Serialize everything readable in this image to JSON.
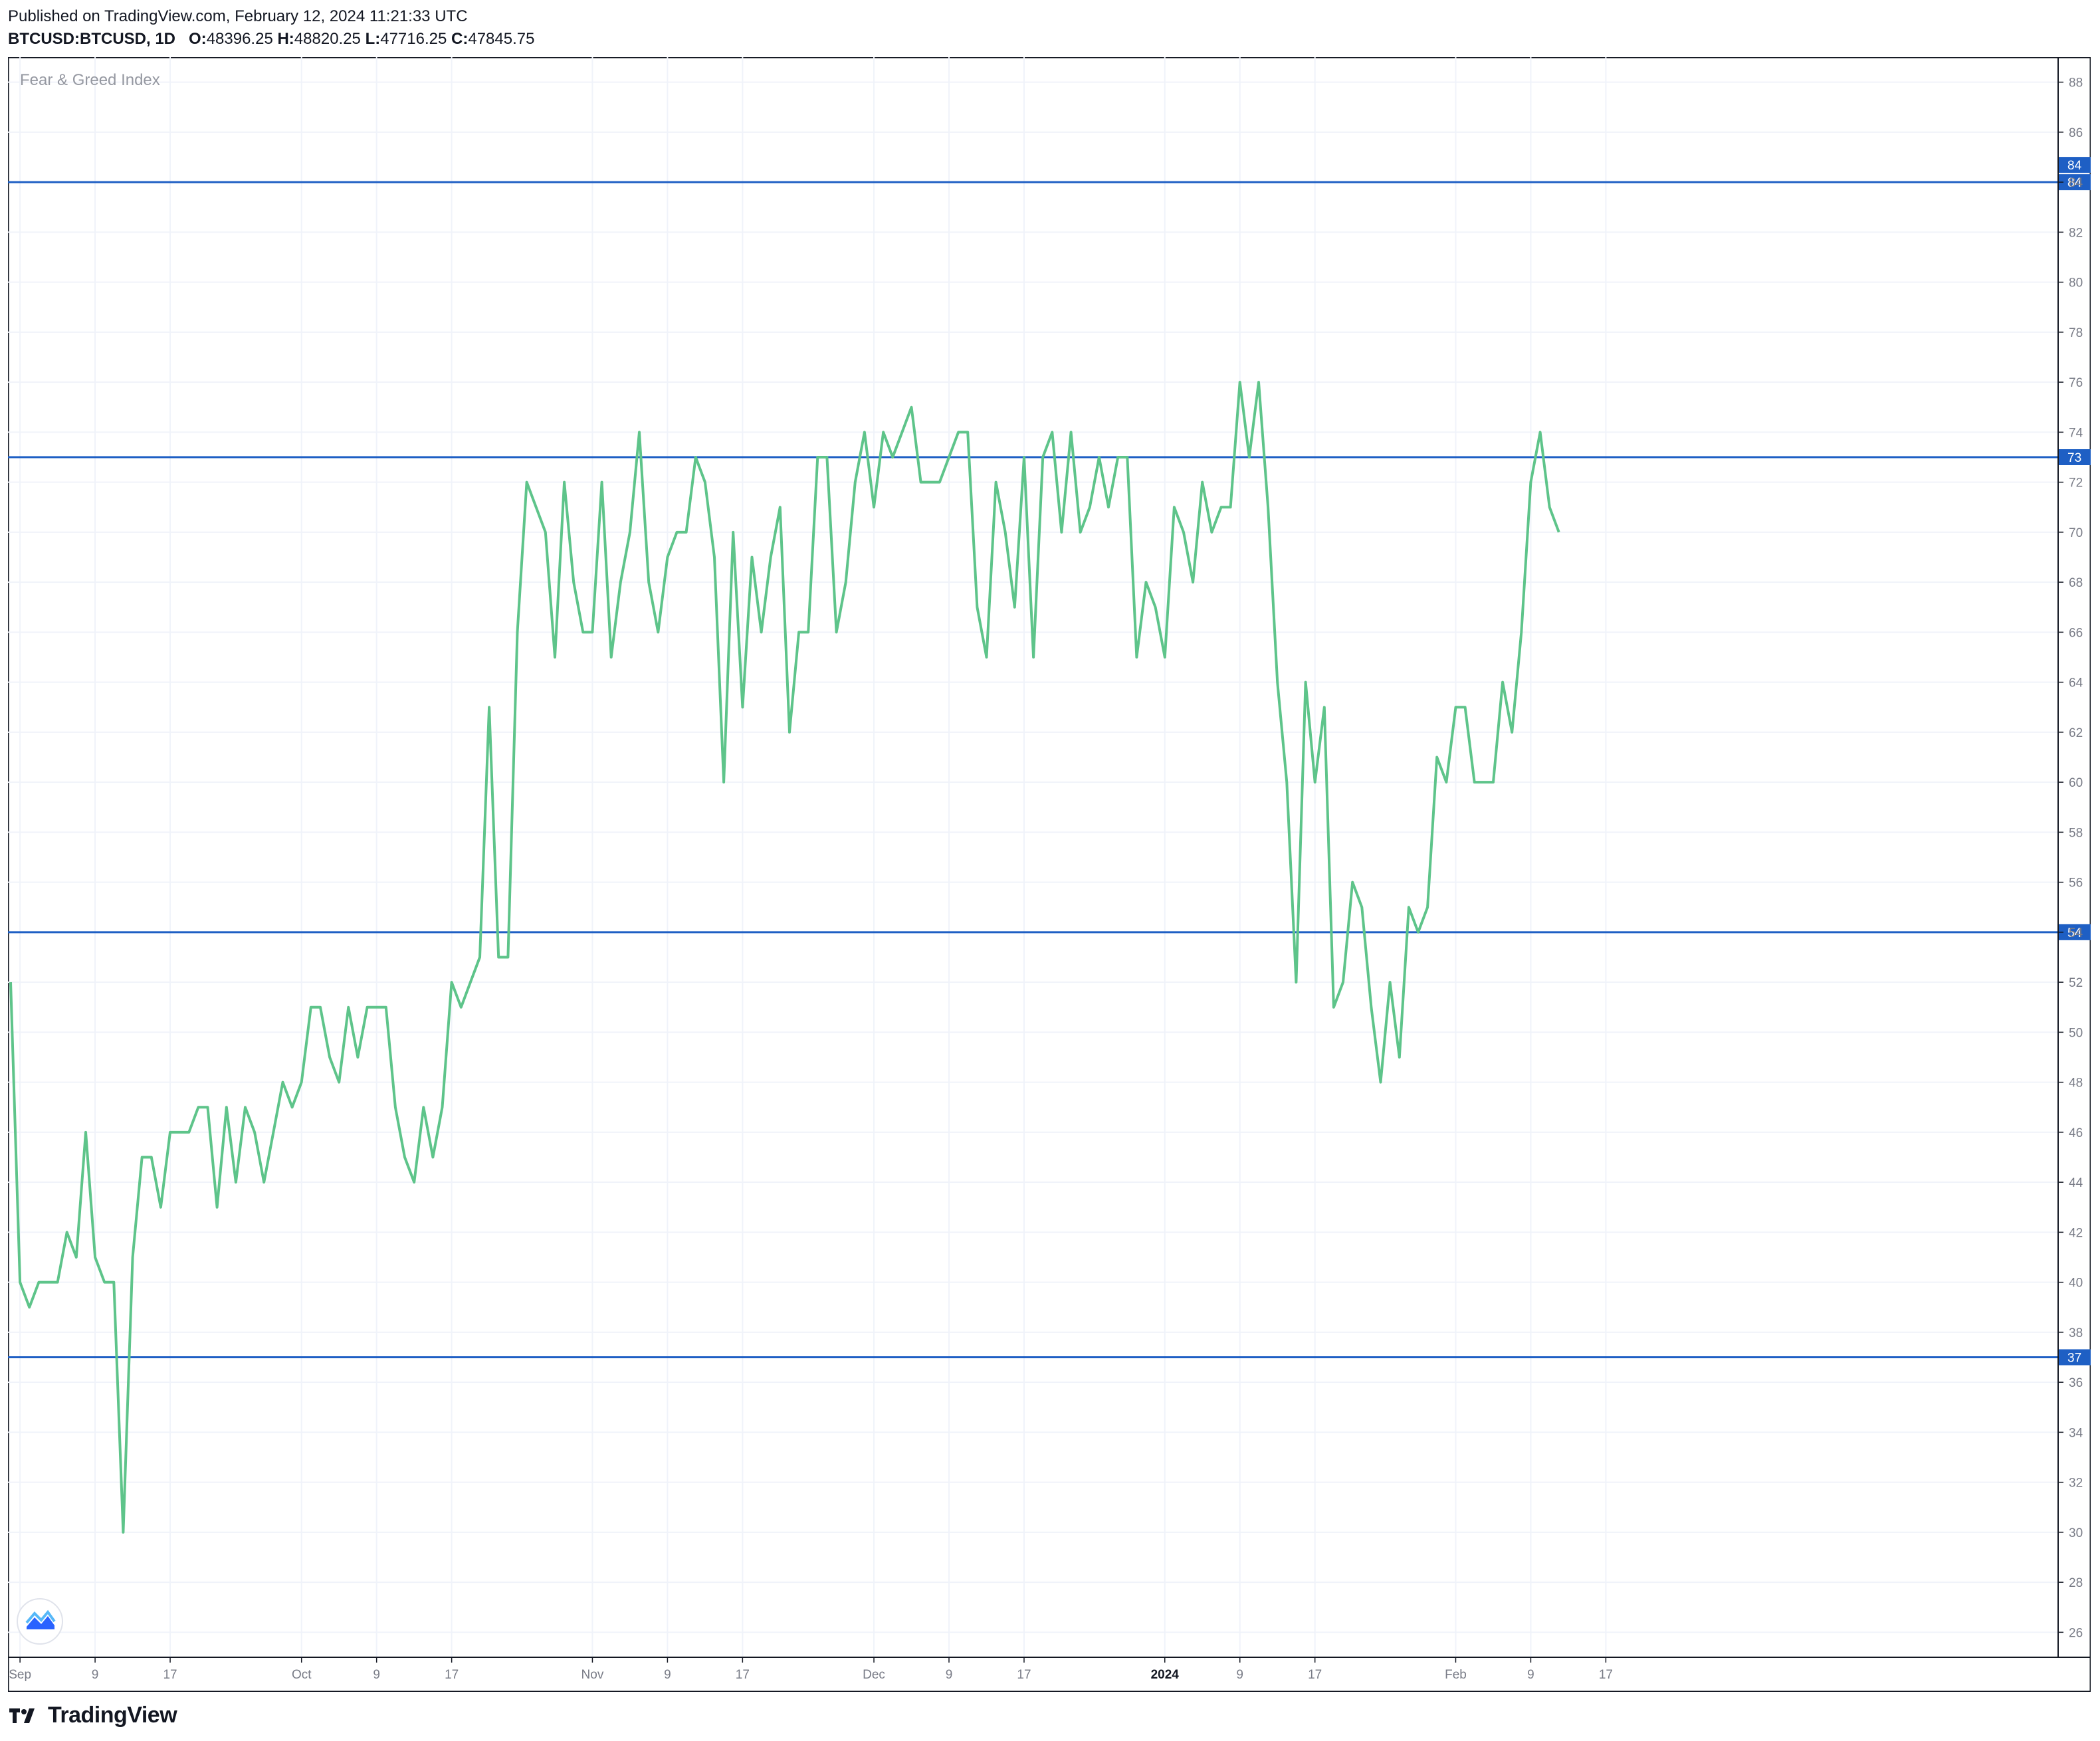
{
  "header": {
    "published": "Published on TradingView.com, February 12, 2024 11:21:33 UTC",
    "symbol": "BTCUSD:BTCUSD, 1D",
    "o_label": "O:",
    "o_value": "48396.25",
    "h_label": "H:",
    "h_value": "48820.25",
    "l_label": "L:",
    "l_value": "47716.25",
    "c_label": "C:",
    "c_value": "47845.75"
  },
  "footer": {
    "brand": "TradingView"
  },
  "colors": {
    "series": "#5ec48a",
    "hline": "#1e5fc4",
    "grid": "#f0f3fa",
    "axis_text": "#787b86"
  },
  "chart_data": {
    "type": "line",
    "title": "Fear & Greed Index",
    "xlabel": "",
    "ylabel": "",
    "ylim": [
      25,
      89
    ],
    "y_ticks": [
      26,
      28,
      30,
      32,
      34,
      36,
      38,
      40,
      42,
      44,
      46,
      48,
      50,
      52,
      54,
      56,
      58,
      60,
      62,
      64,
      66,
      68,
      70,
      72,
      74,
      76,
      78,
      80,
      82,
      84,
      86,
      88
    ],
    "x_ticks": [
      {
        "label": "Sep",
        "day": 1
      },
      {
        "label": "9",
        "day": 9
      },
      {
        "label": "17",
        "day": 17
      },
      {
        "label": "Oct",
        "day": 31
      },
      {
        "label": "9",
        "day": 39
      },
      {
        "label": "17",
        "day": 47
      },
      {
        "label": "Nov",
        "day": 62
      },
      {
        "label": "9",
        "day": 70
      },
      {
        "label": "17",
        "day": 78
      },
      {
        "label": "Dec",
        "day": 92
      },
      {
        "label": "9",
        "day": 100
      },
      {
        "label": "17",
        "day": 108
      },
      {
        "label": "2024",
        "day": 123,
        "bold": true
      },
      {
        "label": "9",
        "day": 131
      },
      {
        "label": "17",
        "day": 139
      },
      {
        "label": "Feb",
        "day": 154
      },
      {
        "label": "9",
        "day": 162
      },
      {
        "label": "17",
        "day": 170
      }
    ],
    "hlines": [
      84,
      73,
      54,
      37
    ],
    "x_start_day": 0,
    "values": [
      52,
      40,
      39,
      40,
      40,
      40,
      42,
      41,
      46,
      41,
      40,
      40,
      30,
      41,
      45,
      45,
      43,
      46,
      46,
      46,
      47,
      47,
      43,
      47,
      44,
      47,
      46,
      44,
      46,
      48,
      47,
      48,
      51,
      51,
      49,
      48,
      51,
      49,
      51,
      51,
      51,
      47,
      45,
      44,
      47,
      45,
      47,
      52,
      51,
      52,
      53,
      63,
      53,
      53,
      66,
      72,
      71,
      70,
      65,
      72,
      68,
      66,
      66,
      72,
      65,
      68,
      70,
      74,
      68,
      66,
      69,
      70,
      70,
      73,
      72,
      69,
      60,
      70,
      63,
      69,
      66,
      69,
      71,
      62,
      66,
      66,
      73,
      73,
      66,
      68,
      72,
      74,
      71,
      74,
      73,
      74,
      75,
      72,
      72,
      72,
      73,
      74,
      74,
      67,
      65,
      72,
      70,
      67,
      73,
      65,
      73,
      74,
      70,
      74,
      70,
      71,
      73,
      71,
      73,
      73,
      65,
      68,
      67,
      65,
      71,
      70,
      68,
      72,
      70,
      71,
      71,
      76,
      73,
      76,
      71,
      64,
      60,
      52,
      64,
      60,
      63,
      51,
      52,
      56,
      55,
      51,
      48,
      52,
      49,
      55,
      54,
      55,
      61,
      60,
      63,
      63,
      60,
      60,
      60,
      64,
      62,
      66,
      72,
      74,
      71,
      70
    ]
  }
}
